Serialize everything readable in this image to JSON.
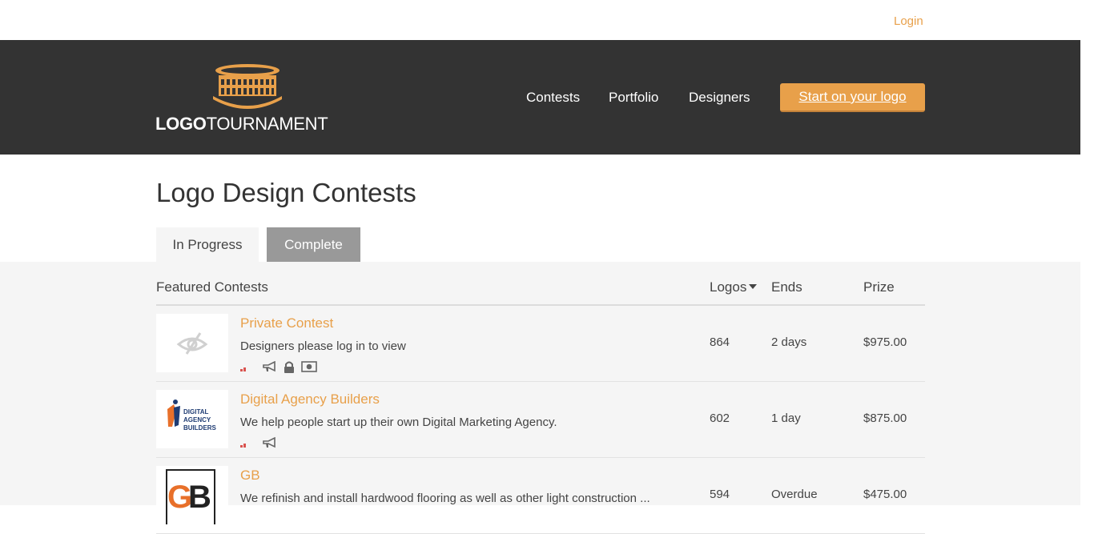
{
  "topbar": {
    "login": "Login"
  },
  "header": {
    "logo_bold": "LOGO",
    "logo_rest": "TOURNAMENT",
    "nav": {
      "contests": "Contests",
      "portfolio": "Portfolio",
      "designers": "Designers"
    },
    "cta": "Start on your logo"
  },
  "page": {
    "title": "Logo Design Contests"
  },
  "tabs": [
    {
      "label": "In Progress",
      "active": true
    },
    {
      "label": "Complete",
      "active": false
    }
  ],
  "table": {
    "headers": {
      "featured": "Featured Contests",
      "logos": "Logos",
      "ends": "Ends",
      "prize": "Prize"
    },
    "rows": [
      {
        "title": "Private Contest",
        "desc": "Designers please log in to view",
        "logos": "864",
        "ends": "2 days",
        "prize": "$975.00",
        "icons": [
          "bars-icon",
          "megaphone-icon",
          "lock-icon",
          "money-icon"
        ]
      },
      {
        "title": "Digital Agency Builders",
        "desc": "We help people start up their own Digital Marketing Agency.",
        "logos": "602",
        "ends": "1 day",
        "prize": "$875.00",
        "thumb_text": [
          "DIGITAL",
          "AGENCY",
          "BUILDERS"
        ],
        "icons": [
          "bars-icon",
          "megaphone-icon"
        ]
      },
      {
        "title": "GB",
        "desc": "We refinish and install hardwood flooring as well as other light construction ...",
        "logos": "594",
        "ends": "Overdue",
        "prize": "$475.00",
        "thumb_text": [
          "G",
          "B"
        ]
      }
    ]
  },
  "colors": {
    "accent": "#e8a04a",
    "header_bg": "#333333",
    "content_bg": "#f5f5f5",
    "tab_complete_bg": "#999999"
  }
}
